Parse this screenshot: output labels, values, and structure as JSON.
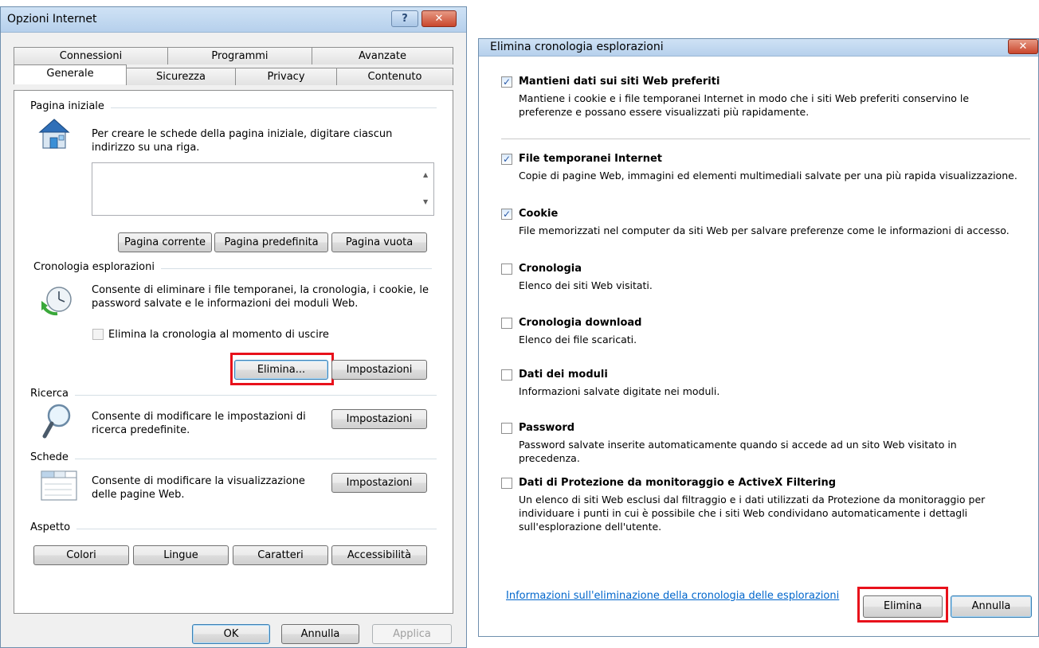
{
  "left_window": {
    "title": "Opzioni Internet",
    "help_glyph": "?",
    "close_glyph": "✕",
    "tabs_row_back": [
      "Connessioni",
      "Programmi",
      "Avanzate"
    ],
    "tabs_row_front": [
      "Generale",
      "Sicurezza",
      "Privacy",
      "Contenuto"
    ],
    "active_tab": "Generale",
    "home_page": {
      "label": "Pagina iniziale",
      "description": "Per creare le schede della pagina iniziale, digitare ciascun indirizzo su una riga.",
      "textarea_value": "",
      "buttons": [
        "Pagina corrente",
        "Pagina predefinita",
        "Pagina vuota"
      ]
    },
    "history": {
      "label": "Cronologia esplorazioni",
      "description": "Consente di eliminare i file temporanei, la cronologia, i cookie, le password salvate e le informazioni dei moduli Web.",
      "checkbox_label": "Elimina la cronologia al momento di uscire",
      "checkbox_checked": false,
      "delete_button": "Elimina...",
      "settings_button": "Impostazioni"
    },
    "search": {
      "label": "Ricerca",
      "description": "Consente di modificare le impostazioni di ricerca predefinite.",
      "settings_button": "Impostazioni"
    },
    "tabs_section": {
      "label": "Schede",
      "description": "Consente di modificare la visualizzazione delle pagine Web.",
      "settings_button": "Impostazioni"
    },
    "appearance": {
      "label": "Aspetto",
      "buttons": [
        "Colori",
        "Lingue",
        "Caratteri",
        "Accessibilità"
      ]
    },
    "footer": {
      "ok": "OK",
      "cancel": "Annulla",
      "apply": "Applica"
    }
  },
  "right_window": {
    "title": "Elimina cronologia esplorazioni",
    "close_glyph": "✕",
    "options": [
      {
        "title": "Mantieni dati sui siti Web preferiti",
        "checked": true,
        "description": "Mantiene i cookie e i file temporanei Internet in modo che i siti Web preferiti conservino le preferenze e possano essere visualizzati più rapidamente."
      },
      {
        "title": "File temporanei Internet",
        "checked": true,
        "description": "Copie di pagine Web, immagini ed elementi multimediali salvate per una più rapida visualizzazione."
      },
      {
        "title": "Cookie",
        "checked": true,
        "description": "File memorizzati nel computer da siti Web per salvare preferenze come le informazioni di accesso."
      },
      {
        "title": "Cronologia",
        "checked": false,
        "description": "Elenco dei siti Web visitati."
      },
      {
        "title": "Cronologia download",
        "checked": false,
        "description": "Elenco dei file scaricati."
      },
      {
        "title": "Dati dei moduli",
        "checked": false,
        "description": "Informazioni salvate digitate nei moduli."
      },
      {
        "title": "Password",
        "checked": false,
        "description": "Password salvate inserite automaticamente quando si accede ad un sito Web visitato in precedenza."
      },
      {
        "title": "Dati di Protezione da monitoraggio e ActiveX Filtering",
        "checked": false,
        "description": "Un elenco di siti Web esclusi dal filtraggio e i dati utilizzati da Protezione da monitoraggio per individuare i punti in cui è possibile che i siti Web condividano automaticamente i dettagli sull'esplorazione dell'utente."
      }
    ],
    "link": "Informazioni sull'eliminazione della cronologia delle esplorazioni",
    "delete_button": "Elimina",
    "cancel_button": "Annulla"
  },
  "check_glyph": "✓",
  "colors": {
    "highlight": "#e8111b",
    "title_bar": "#b6d0ec",
    "link": "#0066cc"
  }
}
